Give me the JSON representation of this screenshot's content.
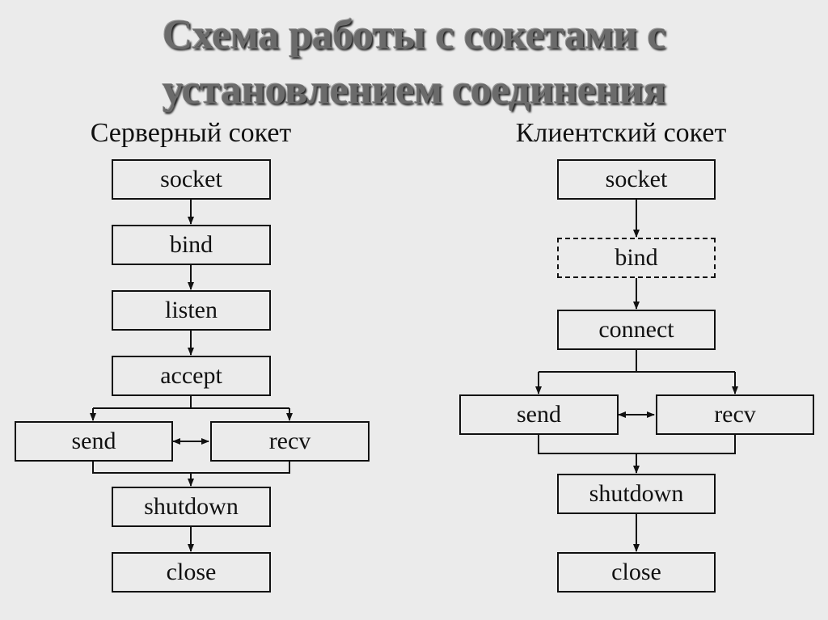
{
  "title": {
    "line1": "Схема работы с сокетами с",
    "line2": "установлением соединения"
  },
  "server": {
    "heading": "Серверный сокет",
    "steps": {
      "socket": "socket",
      "bind": "bind",
      "listen": "listen",
      "accept": "accept",
      "send": "send",
      "recv": "recv",
      "shutdown": "shutdown",
      "close": "close"
    }
  },
  "client": {
    "heading": "Клиентский сокет",
    "steps": {
      "socket": "socket",
      "bind": "bind",
      "bind_optional": true,
      "connect": "connect",
      "send": "send",
      "recv": "recv",
      "shutdown": "shutdown",
      "close": "close"
    }
  },
  "colors": {
    "background": "#ebebeb",
    "line": "#111111",
    "title": "#6b6b6b"
  }
}
